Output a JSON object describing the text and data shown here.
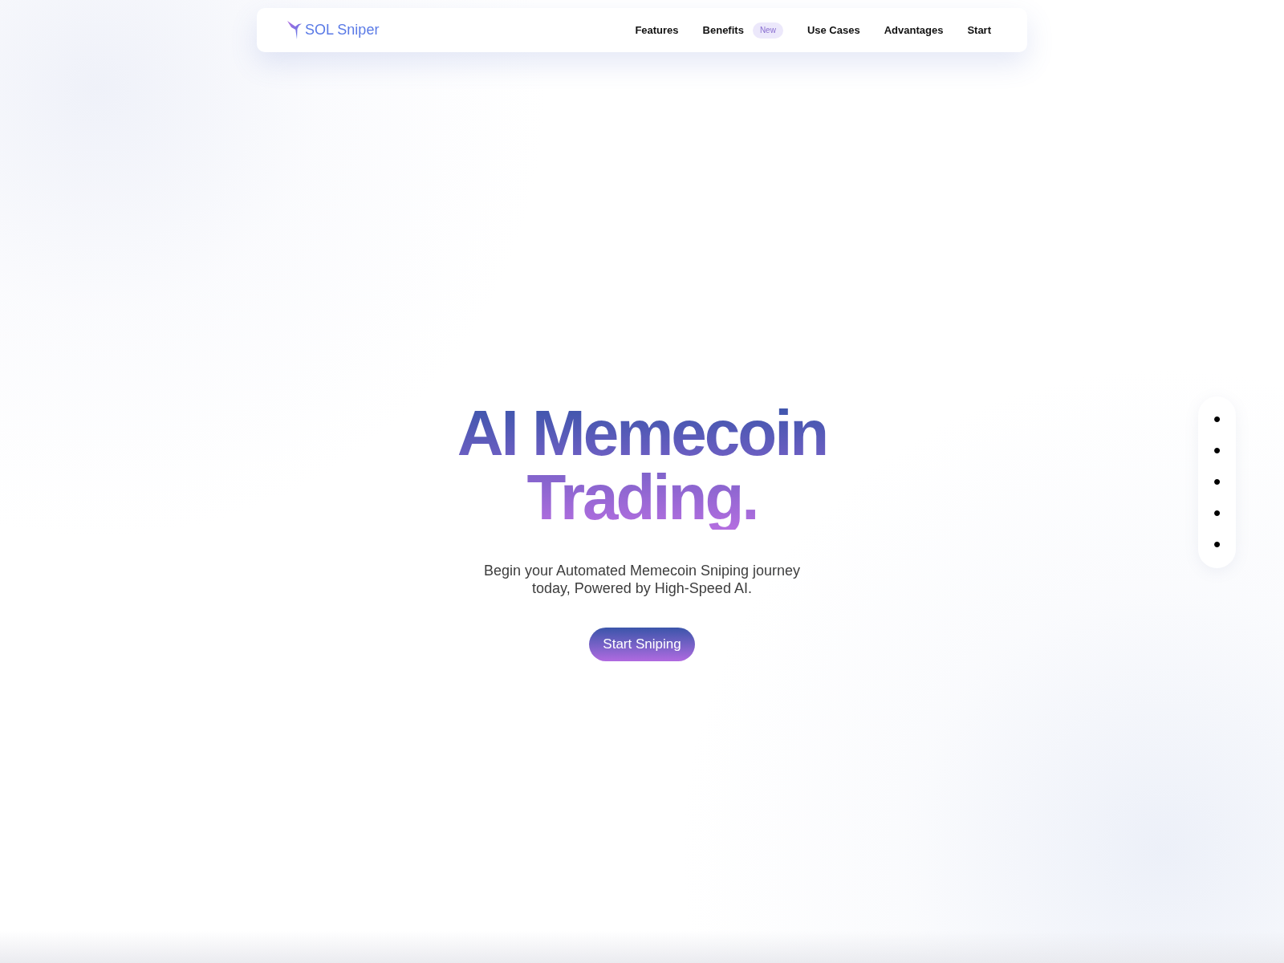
{
  "navbar": {
    "brand": "SOL Sniper",
    "links": [
      {
        "label": "Features"
      },
      {
        "label": "Benefits",
        "badge": "New"
      },
      {
        "label": "Use Cases"
      },
      {
        "label": "Advantages"
      },
      {
        "label": "Start"
      }
    ]
  },
  "hero": {
    "title": "AI Memecoin Trading.",
    "subtitle": "Begin your Automated Memecoin Sniping journey today, Powered by High-Speed AI.",
    "button": "Start Sniping"
  },
  "section_dots": [
    "•",
    "•",
    "•",
    "•",
    "•"
  ]
}
